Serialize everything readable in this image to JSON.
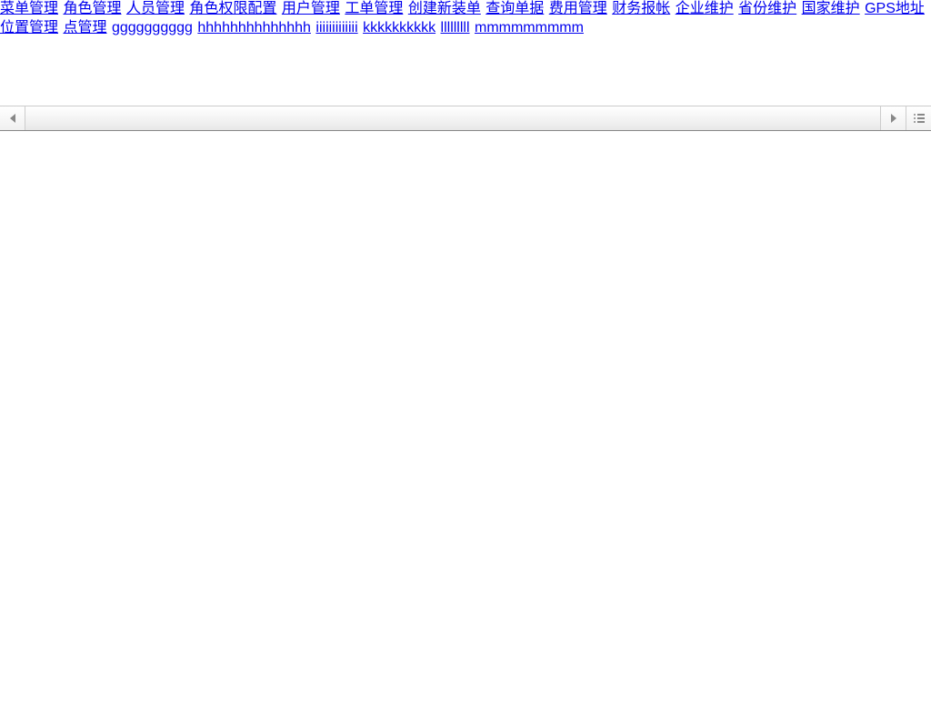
{
  "nav": {
    "links": [
      "菜单管理",
      "角色管理",
      "人员管理",
      "角色权限配置",
      "用户管理",
      "工单管理",
      "创建新装单",
      "查询单据",
      "费用管理",
      "财务报帐",
      "企业维护",
      "省份维护",
      "国家维护",
      "GPS地址位置管理",
      "点管理",
      "gggggggggg",
      "hhhhhhhhhhhhhh",
      "iiiiiiiiiiiii",
      "kkkkkkkkkk",
      "lllllllll",
      "mmmmmmmmm"
    ]
  }
}
